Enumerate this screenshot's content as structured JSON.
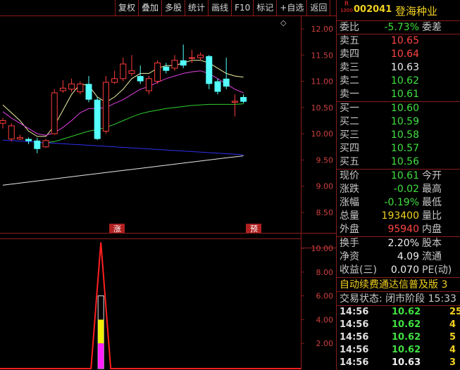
{
  "toolbar": {
    "items": [
      "复权",
      "叠加",
      "多股",
      "统计",
      "画线",
      "F10",
      "标记",
      "+自选",
      "返回"
    ]
  },
  "chart": {
    "price_axis": [
      "12.00",
      "11.50",
      "11.00",
      "10.50",
      "10.00",
      "9.50",
      "9.00",
      "8.50"
    ],
    "indicator_axis": [
      "10.00",
      "8.00",
      "6.00",
      "4.00",
      "2.00"
    ],
    "marker_up": "涨",
    "marker_forecast": "预",
    "diamond": "◇"
  },
  "chart_data": {
    "type": "candlestick",
    "price_ylim": [
      8.2,
      12.2
    ],
    "candles": [
      {
        "o": 10.2,
        "c": 10.25,
        "h": 10.3,
        "l": 10.1
      },
      {
        "o": 9.9,
        "c": 10.15,
        "h": 10.2,
        "l": 9.85
      },
      {
        "o": 9.9,
        "c": 9.93,
        "h": 9.98,
        "l": 9.88
      },
      {
        "o": 9.9,
        "c": 9.86,
        "h": 9.93,
        "l": 9.8
      },
      {
        "o": 9.87,
        "c": 9.71,
        "h": 9.92,
        "l": 9.63
      },
      {
        "o": 9.75,
        "c": 9.87,
        "h": 9.9,
        "l": 9.73
      },
      {
        "o": 10.0,
        "c": 10.78,
        "h": 10.85,
        "l": 9.98
      },
      {
        "o": 10.82,
        "c": 10.87,
        "h": 11.02,
        "l": 10.78
      },
      {
        "o": 10.85,
        "c": 10.95,
        "h": 11.05,
        "l": 10.8
      },
      {
        "o": 10.8,
        "c": 10.95,
        "h": 11.0,
        "l": 10.75
      },
      {
        "o": 10.95,
        "c": 10.65,
        "h": 11.1,
        "l": 10.6
      },
      {
        "o": 10.65,
        "c": 9.9,
        "h": 10.7,
        "l": 9.88
      },
      {
        "o": 10.05,
        "c": 10.98,
        "h": 11.1,
        "l": 10.0
      },
      {
        "o": 10.98,
        "c": 11.05,
        "h": 11.2,
        "l": 10.95
      },
      {
        "o": 11.05,
        "c": 11.33,
        "h": 11.45,
        "l": 11.0
      },
      {
        "o": 11.15,
        "c": 11.2,
        "h": 11.5,
        "l": 11.1
      },
      {
        "o": 11.1,
        "c": 11.0,
        "h": 11.3,
        "l": 10.95
      },
      {
        "o": 10.82,
        "c": 11.05,
        "h": 11.1,
        "l": 10.75
      },
      {
        "o": 11.0,
        "c": 11.35,
        "h": 11.4,
        "l": 10.95
      },
      {
        "o": 11.28,
        "c": 11.2,
        "h": 11.35,
        "l": 11.15
      },
      {
        "o": 11.25,
        "c": 11.4,
        "h": 11.5,
        "l": 11.2
      },
      {
        "o": 11.4,
        "c": 11.3,
        "h": 11.7,
        "l": 11.25
      },
      {
        "o": 11.45,
        "c": 11.45,
        "h": 11.6,
        "l": 11.35
      },
      {
        "o": 11.45,
        "c": 11.5,
        "h": 11.55,
        "l": 11.4
      },
      {
        "o": 11.48,
        "c": 10.95,
        "h": 11.5,
        "l": 10.85
      },
      {
        "o": 11.0,
        "c": 10.8,
        "h": 11.05,
        "l": 10.75
      },
      {
        "o": 11.05,
        "c": 10.9,
        "h": 11.45,
        "l": 10.85
      },
      {
        "o": 10.6,
        "c": 10.62,
        "h": 10.75,
        "l": 10.33
      },
      {
        "o": 10.7,
        "c": 10.61,
        "h": 10.75,
        "l": 10.58
      }
    ],
    "ma_lines": [
      {
        "color": "#f0f0a0",
        "values": [
          10.55,
          10.4,
          10.25,
          10.05,
          9.95,
          9.95,
          10.15,
          10.45,
          10.75,
          10.95,
          10.92,
          10.7,
          10.6,
          10.7,
          10.85,
          11.05,
          11.15,
          11.15,
          11.25,
          11.3,
          11.3,
          11.35,
          11.4,
          11.4,
          11.35,
          11.25,
          11.15,
          11.1,
          11.08
        ]
      },
      {
        "color": "#e040e0",
        "values": [
          10.42,
          10.3,
          10.2,
          10.1,
          10.0,
          9.97,
          10.02,
          10.12,
          10.25,
          10.4,
          10.48,
          10.48,
          10.5,
          10.58,
          10.65,
          10.75,
          10.85,
          10.9,
          10.98,
          11.05,
          11.1,
          11.15,
          11.18,
          11.2,
          11.15,
          11.05,
          10.95,
          10.85,
          10.78
        ]
      },
      {
        "color": "#30d030",
        "values": [
          null,
          null,
          null,
          null,
          9.83,
          9.83,
          9.85,
          9.9,
          9.95,
          10.0,
          10.05,
          10.08,
          10.12,
          10.18,
          10.25,
          10.32,
          10.38,
          10.42,
          10.45,
          10.48,
          10.5,
          10.52,
          10.54,
          10.55,
          10.56,
          10.56,
          10.56,
          10.56,
          10.57
        ]
      },
      {
        "color": "#3030f0",
        "values": [
          9.88,
          9.87,
          9.86,
          9.85,
          9.84,
          9.83,
          9.82,
          9.81,
          9.8,
          9.79,
          9.78,
          9.77,
          9.76,
          9.75,
          9.74,
          9.73,
          9.72,
          9.71,
          9.7,
          9.69,
          9.68,
          9.67,
          9.66,
          9.65,
          9.64,
          9.63,
          9.62,
          9.61,
          9.6
        ]
      },
      {
        "color": "#e8e8e8",
        "values": [
          9.02,
          9.04,
          9.06,
          9.08,
          9.1,
          9.12,
          9.14,
          9.16,
          9.18,
          9.2,
          9.22,
          9.24,
          9.26,
          9.28,
          9.3,
          9.32,
          9.34,
          9.36,
          9.38,
          9.4,
          9.42,
          9.44,
          9.46,
          9.48,
          9.5,
          9.52,
          9.54,
          9.56,
          9.58
        ]
      }
    ],
    "indicator_ylim": [
      0,
      10.8
    ],
    "indicator_peak_index": 11,
    "indicator_peak_value": 10.5,
    "indicator_bar_white": 6.0,
    "indicator_bar_yellow": 4.0,
    "indicator_bar_magenta": 2.0
  },
  "panel": {
    "r_mark": "R",
    "r_sub": "1000",
    "code": "002041",
    "name": "登海种业",
    "ratio": {
      "label": "委比",
      "value": "-5.73%",
      "label2": "委差"
    },
    "sells": [
      {
        "label": "卖五",
        "value": "10.65"
      },
      {
        "label": "卖四",
        "value": "10.64"
      },
      {
        "label": "卖三",
        "value": "10.63"
      },
      {
        "label": "卖二",
        "value": "10.62"
      },
      {
        "label": "卖一",
        "value": "10.61"
      }
    ],
    "buys": [
      {
        "label": "买一",
        "value": "10.60"
      },
      {
        "label": "买二",
        "value": "10.59"
      },
      {
        "label": "买三",
        "value": "10.58"
      },
      {
        "label": "买四",
        "value": "10.57"
      },
      {
        "label": "买五",
        "value": "10.56"
      }
    ],
    "quote": [
      {
        "label": "现价",
        "value": "10.61",
        "label2": "今开"
      },
      {
        "label": "涨跌",
        "value": "-0.02",
        "label2": "最高"
      },
      {
        "label": "涨幅",
        "value": "-0.19%",
        "label2": "最低"
      },
      {
        "label": "总量",
        "value": "193400",
        "label2": "量比"
      },
      {
        "label": "外盘",
        "value": "95940",
        "label2": "内盘"
      }
    ],
    "fund": [
      {
        "label": "换手",
        "value": "2.20%",
        "label2": "股本"
      },
      {
        "label": "净资",
        "value": "4.09",
        "label2": "流通"
      },
      {
        "label": "收益(三)",
        "value": "0.070",
        "label2": "PE(动)"
      }
    ],
    "scroll_text": "自动续费通达信普及版  3",
    "status": "交易状态: 闭市阶段 15:33",
    "ticks": [
      {
        "time": "14:56",
        "price": "10.62",
        "vol": "25"
      },
      {
        "time": "14:56",
        "price": "10.62",
        "vol": "4"
      },
      {
        "time": "14:56",
        "price": "10.62",
        "vol": "5"
      },
      {
        "time": "14:56",
        "price": "10.62",
        "vol": "4"
      },
      {
        "time": "14:56",
        "price": "10.63",
        "vol": "3"
      }
    ]
  }
}
